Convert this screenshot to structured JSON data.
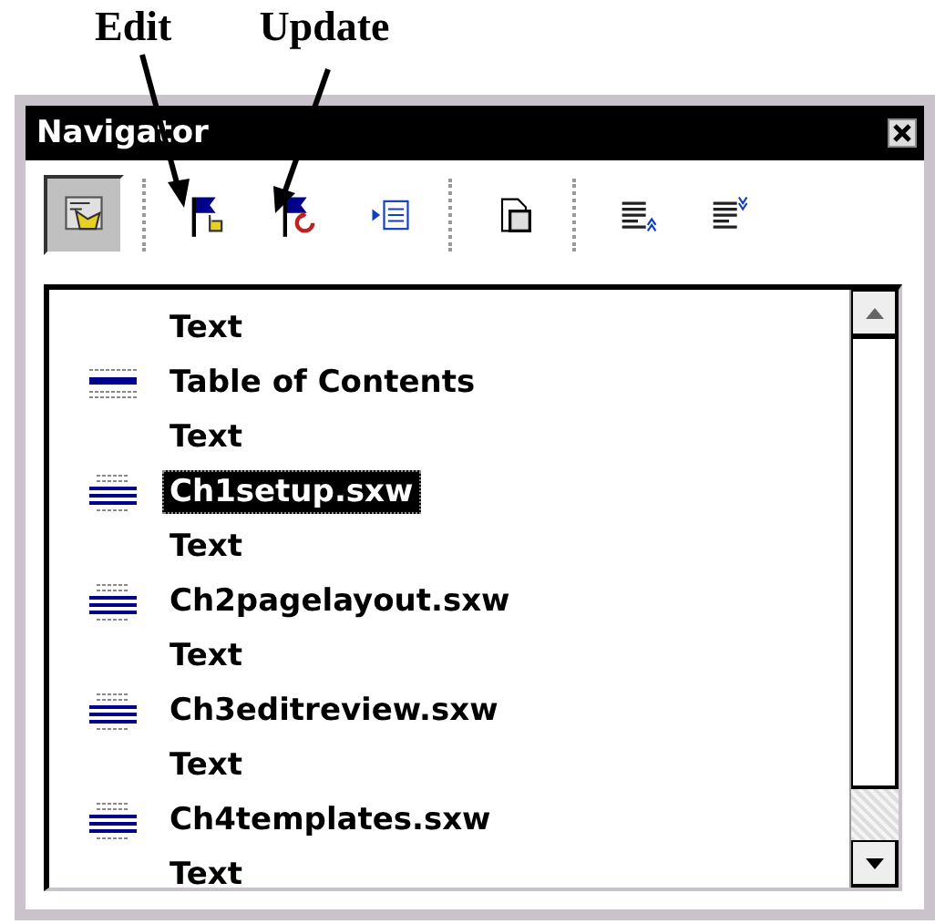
{
  "callouts": [
    {
      "label": "Edit"
    },
    {
      "label": "Update"
    }
  ],
  "window": {
    "title": "Navigator"
  },
  "toolbar_groups": [
    [
      {
        "pressed": true
      }
    ],
    [
      {
        "pressed": false
      },
      {
        "pressed": false
      },
      {
        "pressed": false
      }
    ],
    [
      {
        "pressed": false
      }
    ],
    [
      {
        "pressed": false
      },
      {
        "pressed": false
      }
    ]
  ],
  "items": [
    {
      "label": "Text",
      "kind": "text",
      "selected": false
    },
    {
      "label": "Table of Contents",
      "kind": "index",
      "selected": false
    },
    {
      "label": "Text",
      "kind": "text",
      "selected": false
    },
    {
      "label": "Ch1setup.sxw",
      "kind": "section",
      "selected": true
    },
    {
      "label": "Text",
      "kind": "text",
      "selected": false
    },
    {
      "label": "Ch2pagelayout.sxw",
      "kind": "section",
      "selected": false
    },
    {
      "label": "Text",
      "kind": "text",
      "selected": false
    },
    {
      "label": "Ch3editreview.sxw",
      "kind": "section",
      "selected": false
    },
    {
      "label": "Text",
      "kind": "text",
      "selected": false
    },
    {
      "label": "Ch4templates.sxw",
      "kind": "section",
      "selected": false
    },
    {
      "label": "Text",
      "kind": "text",
      "selected": false
    }
  ]
}
